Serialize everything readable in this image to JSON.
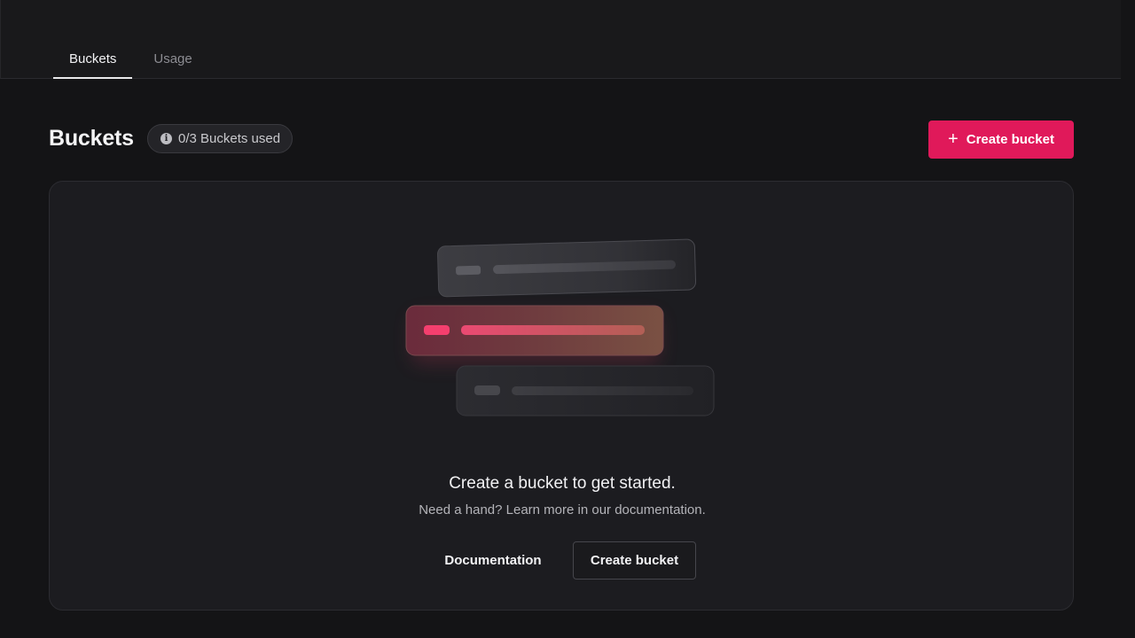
{
  "tabs": [
    {
      "label": "Buckets",
      "active": true
    },
    {
      "label": "Usage",
      "active": false
    }
  ],
  "header": {
    "title": "Buckets",
    "usage_badge": "0/3 Buckets used",
    "create_button": "Create bucket"
  },
  "empty_state": {
    "heading": "Create a bucket to get started.",
    "subtext": "Need a hand? Learn more in our documentation.",
    "documentation_button": "Documentation",
    "create_button": "Create bucket"
  },
  "icons": {
    "badge": "info-icon",
    "create": "plus-icon"
  },
  "colors": {
    "accent": "#e0195a",
    "background": "#141416",
    "card": "#1c1c20"
  }
}
